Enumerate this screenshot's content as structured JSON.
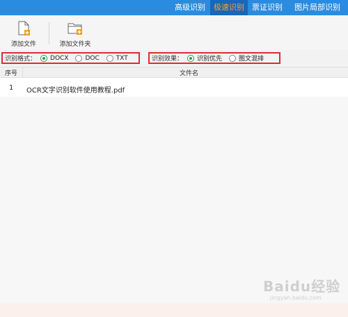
{
  "tabs": [
    {
      "label": "高级识别",
      "active": false
    },
    {
      "label": "极速识别",
      "active": true
    },
    {
      "label": "票证识别",
      "active": false
    },
    {
      "label": "图片局部识别",
      "active": false
    }
  ],
  "toolbar": {
    "add_file_label": "添加文件",
    "add_folder_label": "添加文件夹"
  },
  "options": {
    "format_label": "识别格式：",
    "formats": [
      {
        "label": "DOCX",
        "selected": true
      },
      {
        "label": "DOC",
        "selected": false
      },
      {
        "label": "TXT",
        "selected": false
      }
    ],
    "effect_label": "识别效果：",
    "effects": [
      {
        "label": "识别优先",
        "selected": true
      },
      {
        "label": "图文混排",
        "selected": false
      }
    ]
  },
  "table": {
    "col_num": "序号",
    "col_name": "文件名",
    "rows": [
      {
        "num": "1",
        "name": "OCR文字识别软件使用教程.pdf"
      }
    ]
  },
  "watermark": {
    "main": "Baidu经验",
    "sub": "jingyan.baidu.com"
  },
  "colors": {
    "topbar": "#2a8ce0",
    "active_tab_bg": "#1768b9",
    "active_tab_text": "#ff9d2a",
    "highlight_border": "#e02a2a",
    "radio_on": "#1fa04a"
  }
}
